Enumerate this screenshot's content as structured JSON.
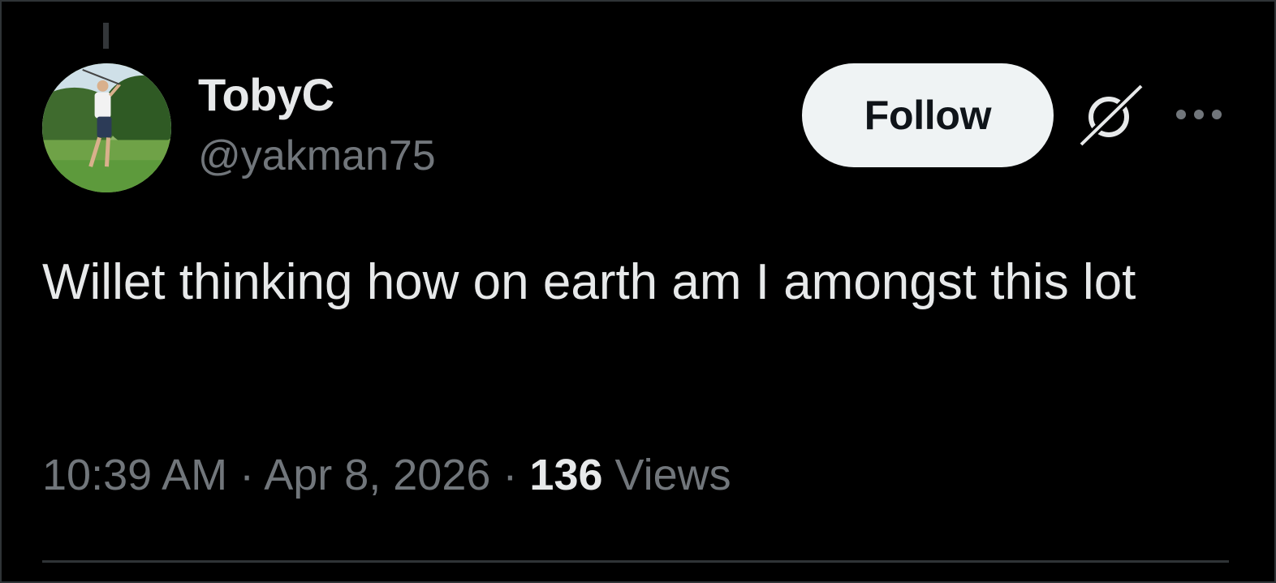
{
  "author": {
    "display_name": "TobyC",
    "handle": "@yakman75"
  },
  "actions": {
    "follow_label": "Follow",
    "grok_icon": "grok-icon",
    "more_icon": "more-icon"
  },
  "post": {
    "text": "Willet thinking how on earth am I amongst this lot"
  },
  "meta": {
    "time": "10:39 AM",
    "separator": "·",
    "date": "Apr 8, 2026",
    "views_count": "136",
    "views_label": "Views"
  },
  "colors": {
    "background": "#000000",
    "primary_text": "#e7e9ea",
    "secondary_text": "#71767b",
    "button_bg": "#eff3f4",
    "border": "#2f3336"
  }
}
